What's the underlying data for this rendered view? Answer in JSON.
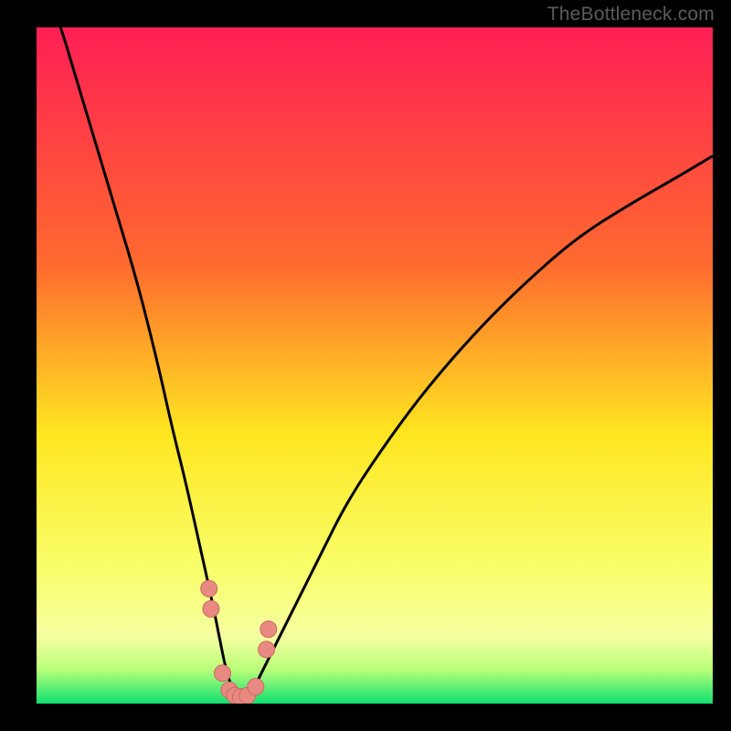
{
  "attribution": "TheBottleneck.com",
  "colors": {
    "bg": "#000000",
    "grad_top": "#ff1f54",
    "grad_mid1": "#ff8a2a",
    "grad_mid2": "#ffe620",
    "grad_low1": "#f8ff6a",
    "grad_low2": "#9dff6a",
    "grad_bottom": "#10e070",
    "curve": "#000000",
    "marker_fill": "#e98a82",
    "marker_stroke": "#c96a60"
  },
  "chart_data": {
    "type": "line",
    "title": "",
    "xlabel": "",
    "ylabel": "",
    "xlim": [
      0,
      100
    ],
    "ylim": [
      0,
      100
    ],
    "x": [
      0,
      3,
      6,
      9,
      12,
      15,
      18,
      20,
      22,
      24,
      26,
      27,
      28,
      29,
      30,
      31,
      32,
      33,
      35,
      38,
      42,
      46,
      52,
      58,
      65,
      72,
      80,
      88,
      95,
      100
    ],
    "values": [
      110,
      102,
      92,
      82,
      72,
      62,
      50,
      41,
      33,
      24,
      15,
      10,
      5,
      2,
      0.5,
      0.5,
      2,
      4,
      8,
      14,
      22,
      30,
      39,
      47,
      55,
      62,
      69,
      74,
      78,
      81
    ],
    "markers": [
      {
        "x": 25.5,
        "y": 17
      },
      {
        "x": 25.8,
        "y": 14
      },
      {
        "x": 27.5,
        "y": 4.5
      },
      {
        "x": 28.5,
        "y": 2.0
      },
      {
        "x": 29.3,
        "y": 1.2
      },
      {
        "x": 30.2,
        "y": 1.0
      },
      {
        "x": 31.2,
        "y": 1.2
      },
      {
        "x": 32.4,
        "y": 2.5
      },
      {
        "x": 34.0,
        "y": 8
      },
      {
        "x": 34.3,
        "y": 11
      }
    ]
  }
}
